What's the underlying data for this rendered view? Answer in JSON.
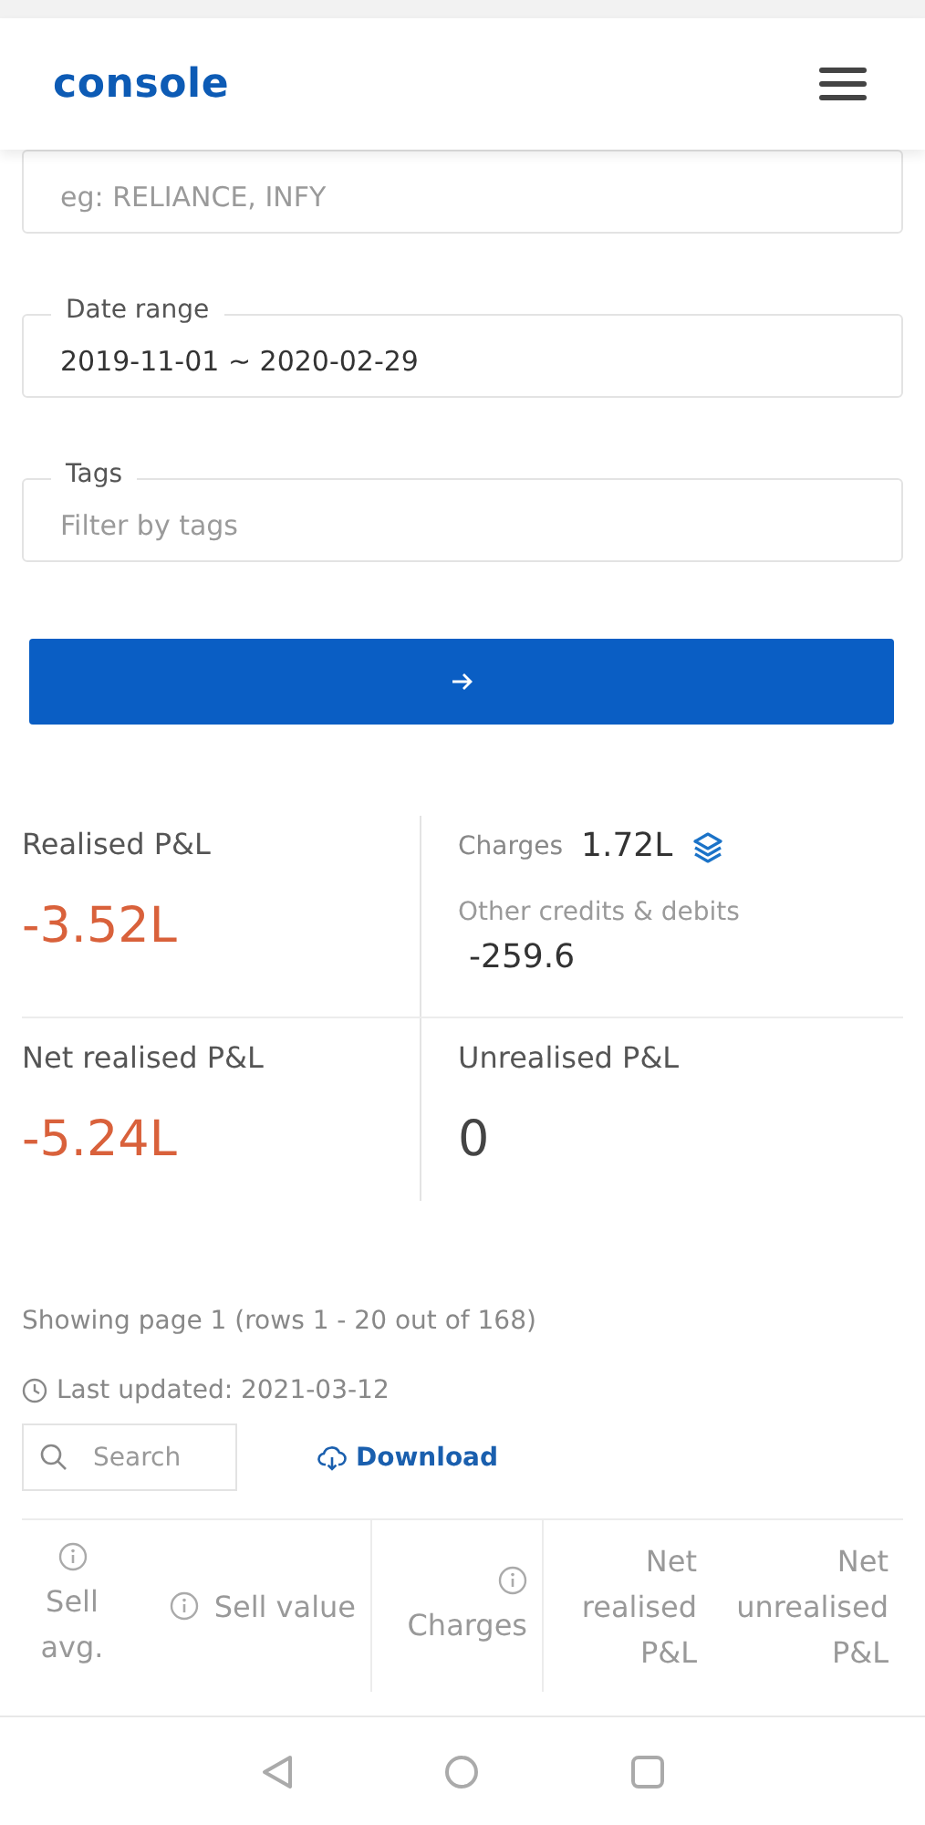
{
  "header": {
    "logo": "console"
  },
  "filters": [
    {
      "placeholder": "eg: RELIANCE, INFY"
    },
    {
      "label": "Date range",
      "value": "2019-11-01 ~ 2020-02-29"
    },
    {
      "label": "Tags",
      "placeholder": "Filter by tags"
    }
  ],
  "stats": [
    {
      "kind": "pnl",
      "label": "Realised P&L",
      "value": "-3.52L",
      "loss": true
    },
    {
      "kind": "charges",
      "label": "Charges",
      "value": "1.72L",
      "other_label": "Other credits & debits",
      "other_value": "-259.6"
    },
    {
      "kind": "pnl",
      "label": "Net realised P&L",
      "value": "-5.24L",
      "loss": true
    },
    {
      "kind": "pnl",
      "label": "Unrealised P&L",
      "value": "0",
      "loss": false
    }
  ],
  "pagination": "Showing page 1 (rows 1 - 20 out of 168)",
  "last_updated": "Last updated: 2021-03-12",
  "search": {
    "placeholder": "Search"
  },
  "download": "Download",
  "table": {
    "columns": [
      {
        "label": "Sell avg.",
        "kind": "centered"
      },
      {
        "label": "Sell value",
        "kind": "inline"
      },
      {
        "label": "Charges",
        "kind": "stacked"
      },
      {
        "label": "Net realised P&L",
        "kind": "plain"
      },
      {
        "label": "Net unrealised P&L",
        "kind": "plain"
      }
    ]
  }
}
